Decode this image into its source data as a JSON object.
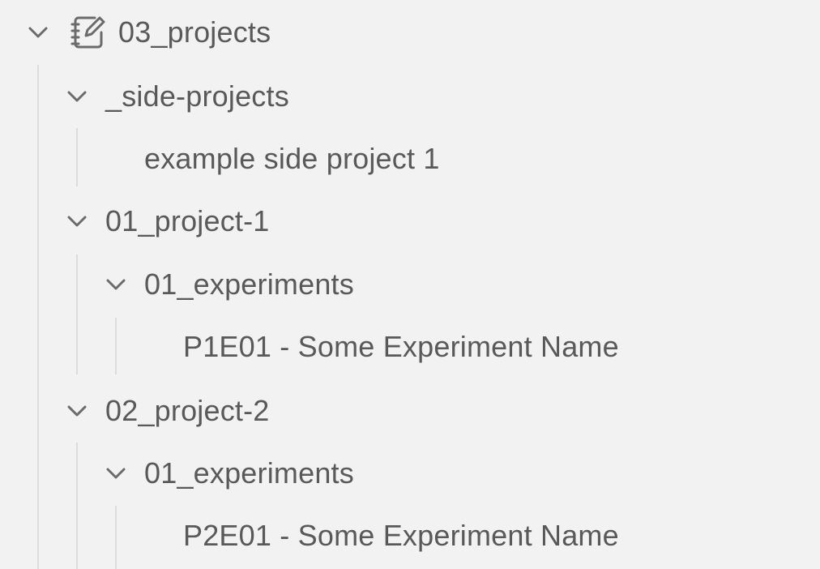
{
  "tree": {
    "root": {
      "label": "03_projects",
      "icon": "notebook-icon",
      "expanded": true
    },
    "items": [
      {
        "label": "_side-projects",
        "depth": 1,
        "type": "folder",
        "expanded": true
      },
      {
        "label": "example side project 1",
        "depth": 2,
        "type": "note"
      },
      {
        "label": "01_project-1",
        "depth": 1,
        "type": "folder",
        "expanded": true
      },
      {
        "label": "01_experiments",
        "depth": 2,
        "type": "folder",
        "expanded": true
      },
      {
        "label": "P1E01 - Some Experiment Name",
        "depth": 3,
        "type": "note"
      },
      {
        "label": "02_project-2",
        "depth": 1,
        "type": "folder",
        "expanded": true
      },
      {
        "label": "01_experiments",
        "depth": 2,
        "type": "folder",
        "expanded": true
      },
      {
        "label": "P2E01 - Some Experiment Name",
        "depth": 3,
        "type": "note"
      }
    ]
  },
  "colors": {
    "background": "#f2f2f2",
    "text": "#595959",
    "chevron": "#6b6b6b",
    "guide_line": "#dcdcdc"
  }
}
